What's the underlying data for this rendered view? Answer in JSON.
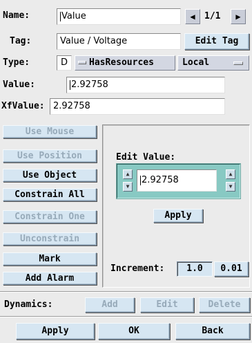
{
  "header": {
    "name_label": "Name:",
    "name_value": "Value",
    "page_indicator": "1/1",
    "tag_label": "Tag:",
    "tag_value": "Value / Voltage",
    "edit_tag_label": "Edit Tag",
    "type_label": "Type:",
    "type_value": "D",
    "has_resources_label": "HasResources",
    "scope_value": "Local",
    "value_label": "Value:",
    "value_value": "2.92758",
    "xfvalue_label": "XfValue:",
    "xfvalue_value": "2.92758"
  },
  "left_buttons": [
    {
      "label": "Use Mouse",
      "enabled": false
    },
    {
      "label": "Use Position",
      "enabled": false
    },
    {
      "label": "Use Object",
      "enabled": true
    },
    {
      "label": "Constrain All",
      "enabled": true
    },
    {
      "label": "Constrain One",
      "enabled": false
    },
    {
      "label": "Unconstrain",
      "enabled": false
    },
    {
      "label": "Mark",
      "enabled": true
    },
    {
      "label": "Add Alarm",
      "enabled": true
    }
  ],
  "edit_panel": {
    "title": "Edit Value:",
    "value": "2.92758",
    "apply_label": "Apply",
    "increment_label": "Increment:",
    "increments": [
      "1.0",
      "0.01"
    ]
  },
  "dynamics": {
    "label": "Dynamics:",
    "add_label": "Add",
    "edit_label": "Edit",
    "delete_label": "Delete"
  },
  "footer": {
    "apply_label": "Apply",
    "ok_label": "OK",
    "back_label": "Back"
  }
}
